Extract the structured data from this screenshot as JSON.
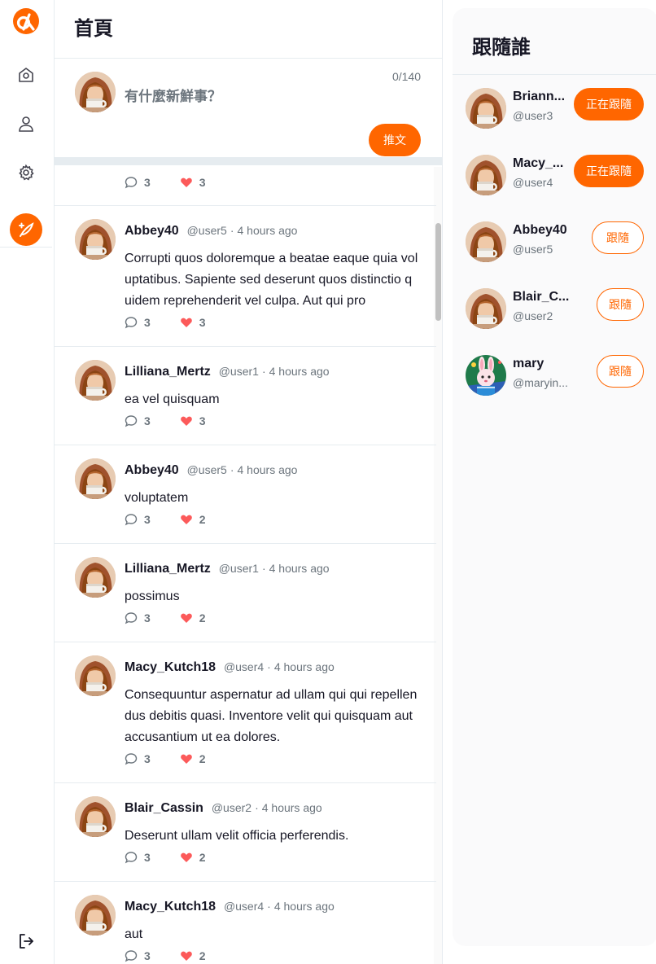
{
  "colors": {
    "accent": "#ff6600",
    "border": "#e6ecf0",
    "muted": "#6c757d",
    "heart": "#fc5a5a"
  },
  "nav": {
    "logo_icon": "alphacamp-logo-icon",
    "items": [
      "home-icon",
      "user-icon",
      "gear-icon"
    ],
    "tweet_icon": "feather-icon",
    "logout_icon": "logout-icon"
  },
  "main": {
    "title": "首頁",
    "composer": {
      "placeholder": "有什麼新鮮事？",
      "count": "0/140",
      "button": "推文"
    },
    "partial_tweet": {
      "replies": "3",
      "likes": "3"
    },
    "tweets": [
      {
        "name": "Abbey40",
        "handle": "@user5",
        "time": "4 hours ago",
        "body": "Corrupti quos doloremque a beatae eaque quia voluptatibus. Sapiente sed deserunt quos distinctio quidem reprehenderit vel culpa. Aut qui pro",
        "replies": "3",
        "likes": "3"
      },
      {
        "name": "Lilliana_Mertz",
        "handle": "@user1",
        "time": "4 hours ago",
        "body": "ea vel quisquam",
        "replies": "3",
        "likes": "3"
      },
      {
        "name": "Abbey40",
        "handle": "@user5",
        "time": "4 hours ago",
        "body": "voluptatem",
        "replies": "3",
        "likes": "2"
      },
      {
        "name": "Lilliana_Mertz",
        "handle": "@user1",
        "time": "4 hours ago",
        "body": "possimus",
        "replies": "3",
        "likes": "2"
      },
      {
        "name": "Macy_Kutch18",
        "handle": "@user4",
        "time": "4 hours ago",
        "body": "Consequuntur aspernatur ad ullam qui qui repellendus debitis quasi. Inventore velit qui quisquam aut accusantium ut ea dolores.",
        "replies": "3",
        "likes": "2"
      },
      {
        "name": "Blair_Cassin",
        "handle": "@user2",
        "time": "4 hours ago",
        "body": "Deserunt ullam velit officia perferendis.",
        "replies": "3",
        "likes": "2"
      },
      {
        "name": "Macy_Kutch18",
        "handle": "@user4",
        "time": "4 hours ago",
        "body": "aut",
        "replies": "3",
        "likes": "2"
      }
    ]
  },
  "side": {
    "title": "跟隨誰",
    "users": [
      {
        "name": "Briann...",
        "handle": "@user3",
        "button": "正在跟隨",
        "following": true,
        "avatar": "photo"
      },
      {
        "name": "Macy_...",
        "handle": "@user4",
        "button": "正在跟隨",
        "following": true,
        "avatar": "photo"
      },
      {
        "name": "Abbey40",
        "handle": "@user5",
        "button": "跟隨",
        "following": false,
        "avatar": "photo"
      },
      {
        "name": "Blair_C...",
        "handle": "@user2",
        "button": "跟隨",
        "following": false,
        "avatar": "photo"
      },
      {
        "name": "mary",
        "handle": "@maryin...",
        "button": "跟隨",
        "following": false,
        "avatar": "rabbit"
      }
    ]
  }
}
